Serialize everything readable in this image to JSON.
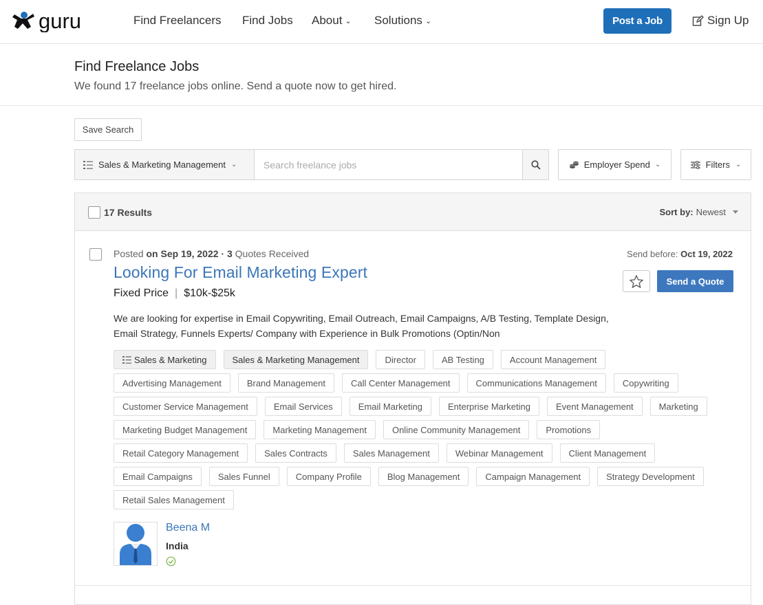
{
  "nav": {
    "logo_text": "guru",
    "links": [
      {
        "label": "Find Freelancers"
      },
      {
        "label": "Find Jobs"
      },
      {
        "label": "About"
      },
      {
        "label": "Solutions"
      }
    ],
    "post_job": "Post a Job",
    "sign_up": "Sign Up"
  },
  "header": {
    "title": "Find Freelance Jobs",
    "subtitle": "We found 17 freelance jobs online. Send a quote now to get hired."
  },
  "save_search": "Save Search",
  "search": {
    "category": "Sales & Marketing Management",
    "placeholder": "Search freelance jobs",
    "employer_spend": "Employer Spend",
    "filters": "Filters"
  },
  "results": {
    "count": "17 Results",
    "sort_label": "Sort by:",
    "sort_value": "Newest"
  },
  "job": {
    "posted_prefix": "Posted",
    "posted_date": "on Sep 19, 2022 · 3",
    "quotes": "Quotes Received",
    "send_before_label": "Send before:",
    "send_before_date": "Oct 19, 2022",
    "title": "Looking For Email Marketing Expert",
    "price_type": "Fixed Price",
    "price_range": "$10k-$25k",
    "send_quote": "Send a Quote",
    "description": "We are looking for expertise in Email Copywriting, Email Outreach, Email Campaigns, A/B Testing, Template Design, Email Strategy, Funnels Experts/ Company with Experience in Bulk Promotions (Optin/Non",
    "tags": [
      "Sales & Marketing",
      "Sales & Marketing Management",
      "Director",
      "AB Testing",
      "Account Management",
      "Advertising Management",
      "Brand Management",
      "Call Center Management",
      "Communications Management",
      "Copywriting",
      "Customer Service Management",
      "Email Services",
      "Email Marketing",
      "Enterprise Marketing",
      "Event Management",
      "Marketing",
      "Marketing Budget Management",
      "Marketing Management",
      "Online Community Management",
      "Promotions",
      "Retail Category Management",
      "Sales Contracts",
      "Sales Management",
      "Webinar Management",
      "Client Management",
      "Email Campaigns",
      "Sales Funnel",
      "Company Profile",
      "Blog Management",
      "Campaign Management",
      "Strategy Development",
      "Retail Sales Management"
    ],
    "owner_name": "Beena M",
    "owner_country": "India"
  },
  "colors": {
    "brand_blue": "#1f6fb8",
    "link_blue": "#3b76b8",
    "button_blue": "#3d78bf",
    "verified_green": "#7cb342"
  }
}
